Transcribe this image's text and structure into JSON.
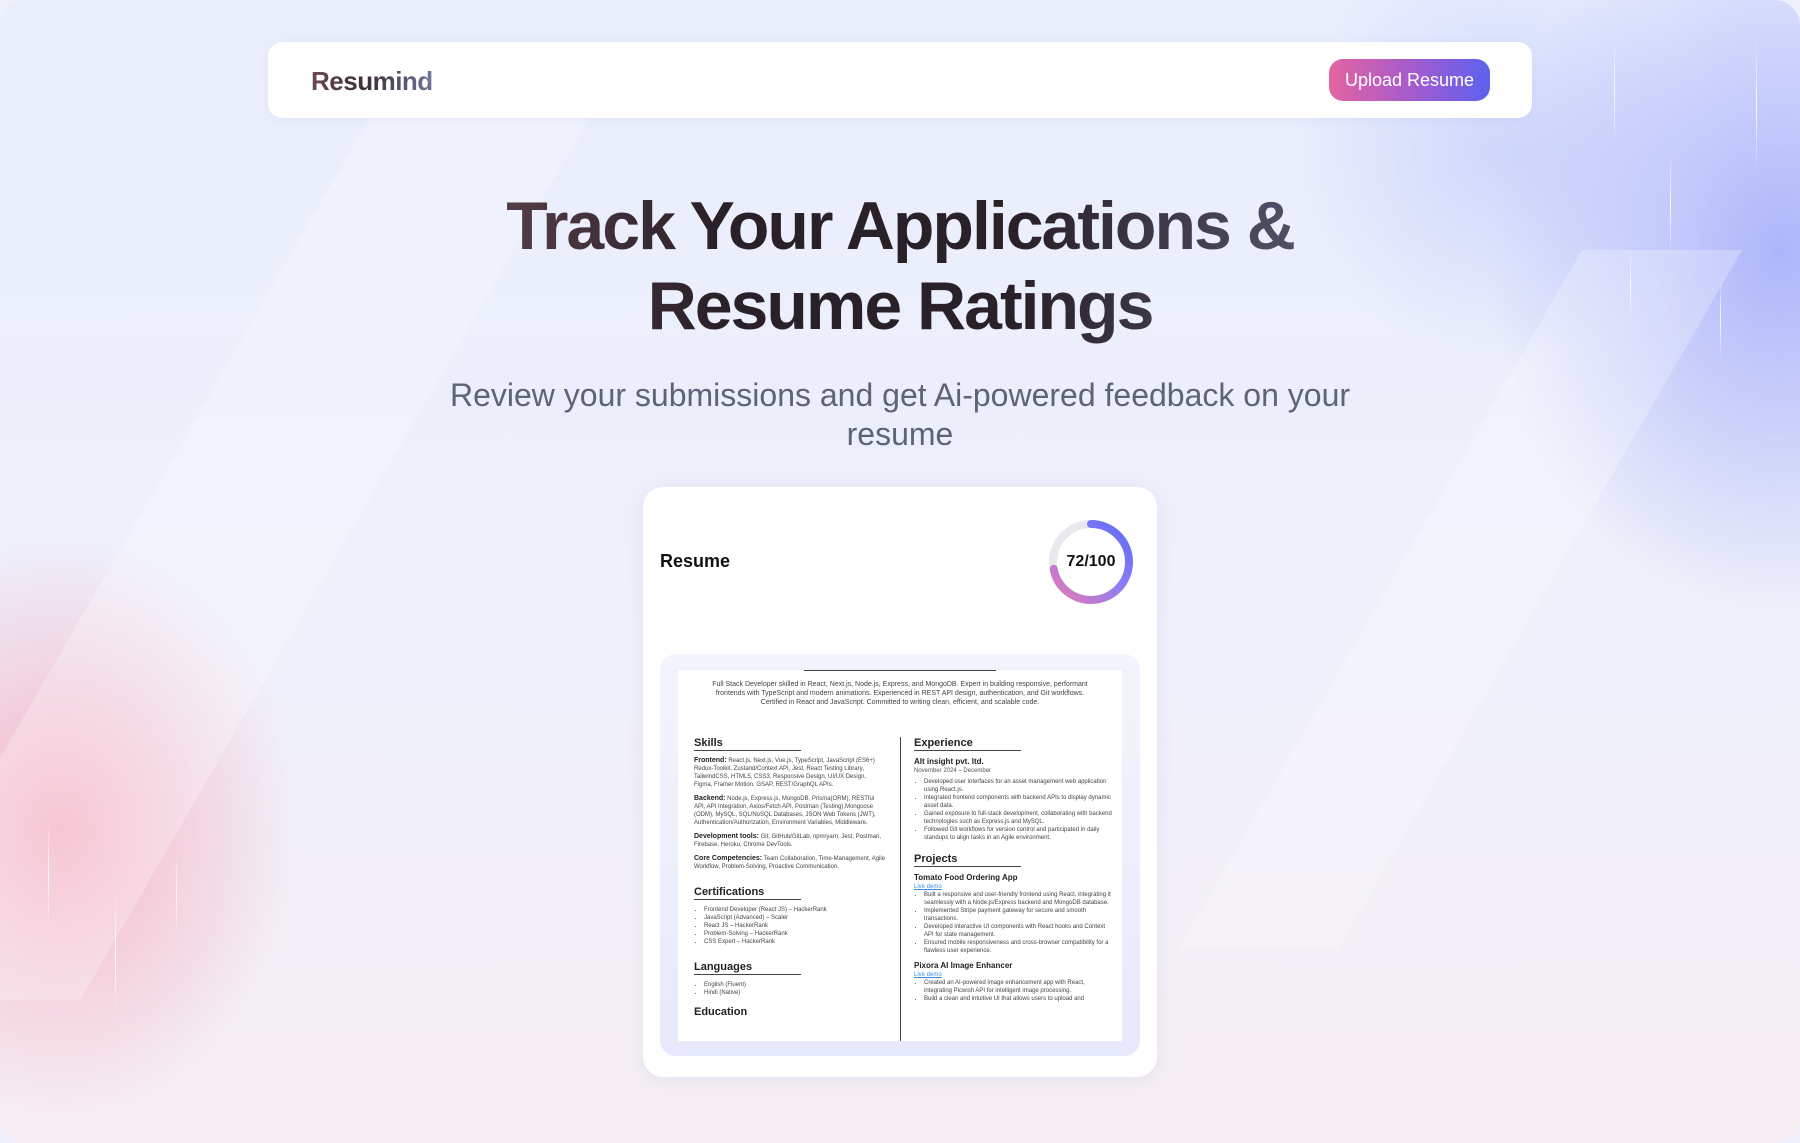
{
  "navbar": {
    "brand": "Resumind",
    "upload_label": "Upload Resume"
  },
  "hero": {
    "title_line1": "Track Your Applications &",
    "title_line2": "Resume Ratings",
    "subtitle": "Review your submissions and get Ai-powered feedback on your resume"
  },
  "card": {
    "title": "Resume",
    "score_label": "72/100",
    "score_fraction": 0.72,
    "ring_colors": [
      "#e879b4",
      "#8b7cf6",
      "#5f6cf3"
    ]
  },
  "preview": {
    "summary": "Full Stack Developer skilled in React, Next.js, Node.js, Express, and MongoDB. Expert in building responsive, performant frontends with TypeScript and modern animations. Experienced in REST API design, authentication, and Git workflows. Certified in React and JavaScript. Committed to writing clean, efficient, and scalable code.",
    "skills_heading": "Skills",
    "skills": [
      {
        "label": "Frontend:",
        "text": "React.js, Next.js, Vue.js, TypeScript, JavaScript (ES6+) Redux-Toolkit, Zustand/Context API, Jest, React Testing Library, TailwindCSS, HTML5, CSS3, Responsive Design, UI/UX Design, Figma, Framer Motion, GSAP, REST/GraphQL APIs."
      },
      {
        "label": "Backend:",
        "text": "Node.js, Express.js, MongoDB, Prisma(ORM), RESTful API, API Integration, Axios/Fetch API, Postman (Testing),Mongoose (ODM), MySQL, SQL/NoSQL Databases, JSON Web Tokens (JWT), Authentication/Authorization, Environment Variables, Middleware."
      },
      {
        "label": "Development tools:",
        "text": "Git, GitHub/GitLab, npm/yarn, Jest, Postman, Firebase, Heroku, Chrome DevTools."
      },
      {
        "label": "Core Competencies:",
        "text": "Team Collaboration, Time-Management, Agile Workflow, Problem-Solving, Proactive Communication."
      }
    ],
    "cert_heading": "Certifications",
    "certs": [
      "Frontend Developer (React JS) – HackerRank",
      "JavaScript (Advanced) – Scaler",
      "React JS – HackerRank",
      "Problem-Solving – HackerRank",
      "CSS Expert – HackerRank"
    ],
    "lang_heading": "Languages",
    "langs": [
      "English (Fluent)",
      "Hindi (Native)"
    ],
    "edu_heading": "Education",
    "exp_heading": "Experience",
    "company": "Alt insight pvt. ltd.",
    "company_date": "November 2024 – December",
    "exp_bullets": [
      "Developed user interfaces for an asset management web application using React.js.",
      "Integrated frontend components with backend APIs to display dynamic asset data.",
      "Gained exposure to full-stack development, collaborating with backend technologies such as Express.js and MySQL.",
      "Followed Git workflows for version control and participated in daily standups to align tasks in an Agile environment."
    ],
    "proj_heading": "Projects",
    "proj1_title": "Tomato Food Ordering App",
    "proj1_link": "Live demo",
    "proj1_bullets": [
      "Built a responsive and user-friendly frontend using React, integrating it seamlessly with a Node.js/Express backend and MongoDB database.",
      "Implemented Stripe payment gateway for secure and smooth transactions.",
      "Developed interactive UI components with React hooks and Context API for state management.",
      "Ensured mobile responsiveness and cross-browser compatibility for a flawless user experience."
    ],
    "proj2_title": "Pixora AI Image Enhancer",
    "proj2_link": "Live demo",
    "proj2_bullets": [
      "Created an AI-powered image enhancement app with React, integrating Picwish API for intelligent image processing.",
      "Build a clean and intuitive UI that allows users to upload and"
    ]
  }
}
